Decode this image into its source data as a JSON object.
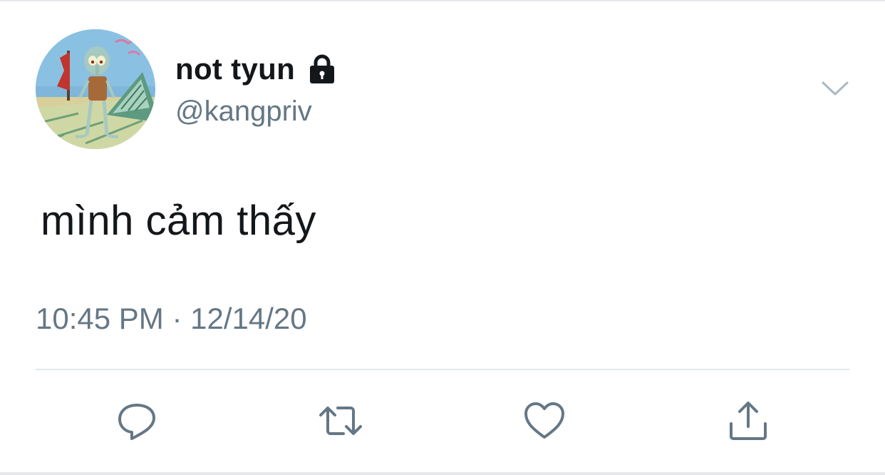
{
  "tweet": {
    "display_name": "not tyun",
    "handle": "@kangpriv",
    "protected_icon": "lock-icon",
    "text": "mình cảm thấy",
    "timestamp": "10:45 PM · 12/14/20",
    "more_icon": "chevron-down-icon"
  },
  "actions": [
    {
      "name": "reply",
      "icon": "reply-icon"
    },
    {
      "name": "retweet",
      "icon": "retweet-icon"
    },
    {
      "name": "like",
      "icon": "heart-icon"
    },
    {
      "name": "share",
      "icon": "share-icon"
    }
  ],
  "colors": {
    "text_primary": "#14171a",
    "text_secondary": "#657786",
    "icon": "#657786",
    "divider": "#e1e8ed",
    "background": "#ffffff"
  }
}
